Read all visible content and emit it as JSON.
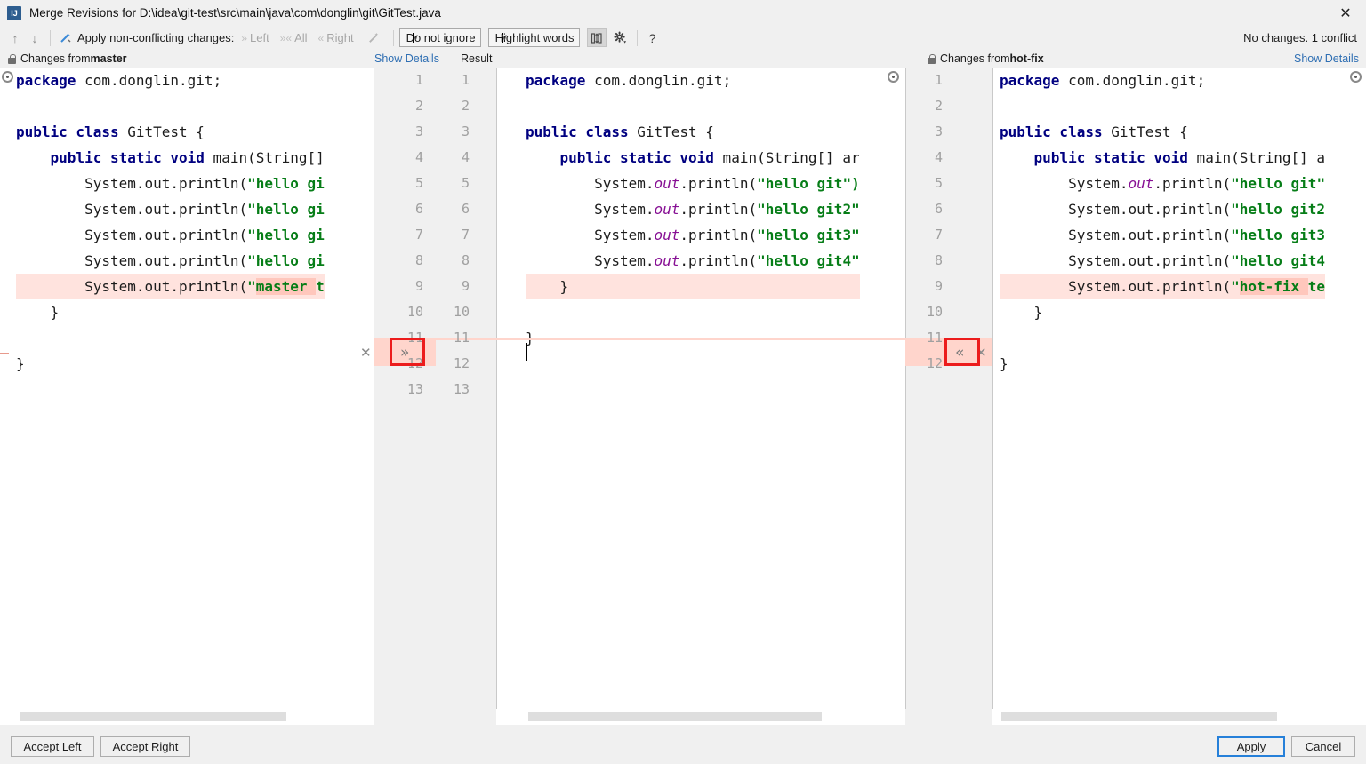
{
  "window": {
    "title": "Merge Revisions for D:\\idea\\git-test\\src\\main\\java\\com\\donglin\\git\\GitTest.java",
    "app_icon": "intellij-idea-icon",
    "close_icon": "✕"
  },
  "toolbar": {
    "prev_icon": "↑",
    "next_icon": "↓",
    "magic_resolve_icon": "magic-wand",
    "apply_label": "Apply non-conflicting changes:",
    "left_chevron": "»",
    "left_label": "Left",
    "all_chevron": "»«",
    "all_label": "All",
    "right_chevron": "«",
    "right_label": "Right",
    "wand_icon": "magic-wand-icon",
    "ignore_combo": "Do not ignore",
    "highlight_combo": "Highlight words",
    "caret": "∨",
    "columns_icon": "collapse-unchanged-icon",
    "gear_icon": "settings-gear-icon",
    "help_icon": "?",
    "status": "No changes. 1 conflict"
  },
  "headers": {
    "left": {
      "prefix": "Changes from ",
      "branch": "master",
      "lock_icon": "lock-icon"
    },
    "left_details": "Show Details",
    "result": "Result",
    "right": {
      "prefix": "Changes from ",
      "branch": "hot-fix",
      "lock_icon": "lock-icon"
    },
    "right_details": "Show Details"
  },
  "gutters": {
    "left_numbers": [
      "1",
      "2",
      "3",
      "4",
      "5",
      "6",
      "7",
      "8",
      "9",
      "10",
      "11",
      "12",
      "13"
    ],
    "right_numbers": [
      "1",
      "2",
      "3",
      "4",
      "5",
      "6",
      "7",
      "8",
      "9",
      "10",
      "11",
      "12"
    ],
    "mid_numbers": [
      "1",
      "2",
      "3",
      "4",
      "5",
      "6",
      "7",
      "8",
      "9",
      "10",
      "11",
      "12",
      "13"
    ],
    "accept_left_icon": "»",
    "accept_right_icon": "«",
    "ignore_icon": "✕"
  },
  "editors": {
    "left": {
      "name": "master",
      "lines": [
        [
          {
            "t": "package",
            "c": "kw"
          },
          {
            "t": " com.donglin.git;",
            "c": "plain"
          }
        ],
        [],
        [
          {
            "t": "public class",
            "c": "kw"
          },
          {
            "t": " GitTest {",
            "c": "plain"
          }
        ],
        [
          {
            "t": "    ",
            "c": "plain"
          },
          {
            "t": "public static void",
            "c": "kw"
          },
          {
            "t": " main(String[]",
            "c": "plain"
          }
        ],
        [
          {
            "t": "        System.out.println(",
            "c": "plain"
          },
          {
            "t": "\"hello gi",
            "c": "str"
          }
        ],
        [
          {
            "t": "        System.out.println(",
            "c": "plain"
          },
          {
            "t": "\"hello gi",
            "c": "str"
          }
        ],
        [
          {
            "t": "        System.out.println(",
            "c": "plain"
          },
          {
            "t": "\"hello gi",
            "c": "str"
          }
        ],
        [
          {
            "t": "        System.out.println(",
            "c": "plain"
          },
          {
            "t": "\"hello gi",
            "c": "str"
          }
        ],
        [
          {
            "t": "        System.out.println(",
            "c": "plain"
          },
          {
            "t": "\"",
            "c": "str"
          },
          {
            "t": "master ",
            "c": "str hl"
          },
          {
            "t": "t",
            "c": "str"
          }
        ],
        [
          {
            "t": "    }",
            "c": "plain"
          }
        ],
        [],
        [
          {
            "t": "}",
            "c": "plain"
          }
        ],
        []
      ],
      "conflict_line": 9
    },
    "mid": {
      "name": "Result",
      "lines": [
        [
          {
            "t": "package",
            "c": "kw"
          },
          {
            "t": " com.donglin.git;",
            "c": "plain"
          }
        ],
        [],
        [
          {
            "t": "public class",
            "c": "kw"
          },
          {
            "t": " GitTest {",
            "c": "plain"
          }
        ],
        [
          {
            "t": "    ",
            "c": "plain"
          },
          {
            "t": "public static void",
            "c": "kw"
          },
          {
            "t": " main(String[] ar",
            "c": "plain"
          }
        ],
        [
          {
            "t": "        System.",
            "c": "plain"
          },
          {
            "t": "out",
            "c": "ital"
          },
          {
            "t": ".println(",
            "c": "plain"
          },
          {
            "t": "\"hello git\")",
            "c": "str"
          }
        ],
        [
          {
            "t": "        System.",
            "c": "plain"
          },
          {
            "t": "out",
            "c": "ital"
          },
          {
            "t": ".println(",
            "c": "plain"
          },
          {
            "t": "\"hello git2\"",
            "c": "str"
          }
        ],
        [
          {
            "t": "        System.",
            "c": "plain"
          },
          {
            "t": "out",
            "c": "ital"
          },
          {
            "t": ".println(",
            "c": "plain"
          },
          {
            "t": "\"hello git3\"",
            "c": "str"
          }
        ],
        [
          {
            "t": "        System.",
            "c": "plain"
          },
          {
            "t": "out",
            "c": "ital"
          },
          {
            "t": ".println(",
            "c": "plain"
          },
          {
            "t": "\"hello git4\"",
            "c": "str"
          }
        ],
        [
          {
            "t": "    }",
            "c": "plain"
          }
        ],
        [],
        [
          {
            "t": "}",
            "c": "plain"
          }
        ],
        [],
        []
      ],
      "conflict_line": 9,
      "caret_line": 9
    },
    "right": {
      "name": "hot-fix",
      "lines": [
        [
          {
            "t": "package",
            "c": "kw"
          },
          {
            "t": " com.donglin.git;",
            "c": "plain"
          }
        ],
        [],
        [
          {
            "t": "public class",
            "c": "kw"
          },
          {
            "t": " GitTest {",
            "c": "plain"
          }
        ],
        [
          {
            "t": "    ",
            "c": "plain"
          },
          {
            "t": "public static void",
            "c": "kw"
          },
          {
            "t": " main(String[] a",
            "c": "plain"
          }
        ],
        [
          {
            "t": "        System.",
            "c": "plain"
          },
          {
            "t": "out",
            "c": "ital"
          },
          {
            "t": ".println(",
            "c": "plain"
          },
          {
            "t": "\"hello git\"",
            "c": "str"
          }
        ],
        [
          {
            "t": "        System.out.println(",
            "c": "plain"
          },
          {
            "t": "\"hello git2",
            "c": "str"
          }
        ],
        [
          {
            "t": "        System.out.println(",
            "c": "plain"
          },
          {
            "t": "\"hello git3",
            "c": "str"
          }
        ],
        [
          {
            "t": "        System.out.println(",
            "c": "plain"
          },
          {
            "t": "\"hello git4",
            "c": "str"
          }
        ],
        [
          {
            "t": "        System.out.println(",
            "c": "plain"
          },
          {
            "t": "\"",
            "c": "str"
          },
          {
            "t": "hot-fix ",
            "c": "str hl"
          },
          {
            "t": "te",
            "c": "str"
          }
        ],
        [
          {
            "t": "    }",
            "c": "plain"
          }
        ],
        [],
        [
          {
            "t": "}",
            "c": "plain"
          }
        ],
        []
      ],
      "conflict_line": 9
    }
  },
  "buttons": {
    "accept_left": "Accept Left",
    "accept_right": "Accept Right",
    "apply": "Apply",
    "cancel": "Cancel"
  },
  "colors": {
    "conflict_bg": "#ffe3de",
    "conflict_word": "#ffc7bc",
    "link": "#2f6fb3",
    "keyword": "#000080",
    "string": "#067d17",
    "italic_field": "#871094",
    "annotation_box": "#ec1c1c",
    "default_button_border": "#2680d9"
  }
}
